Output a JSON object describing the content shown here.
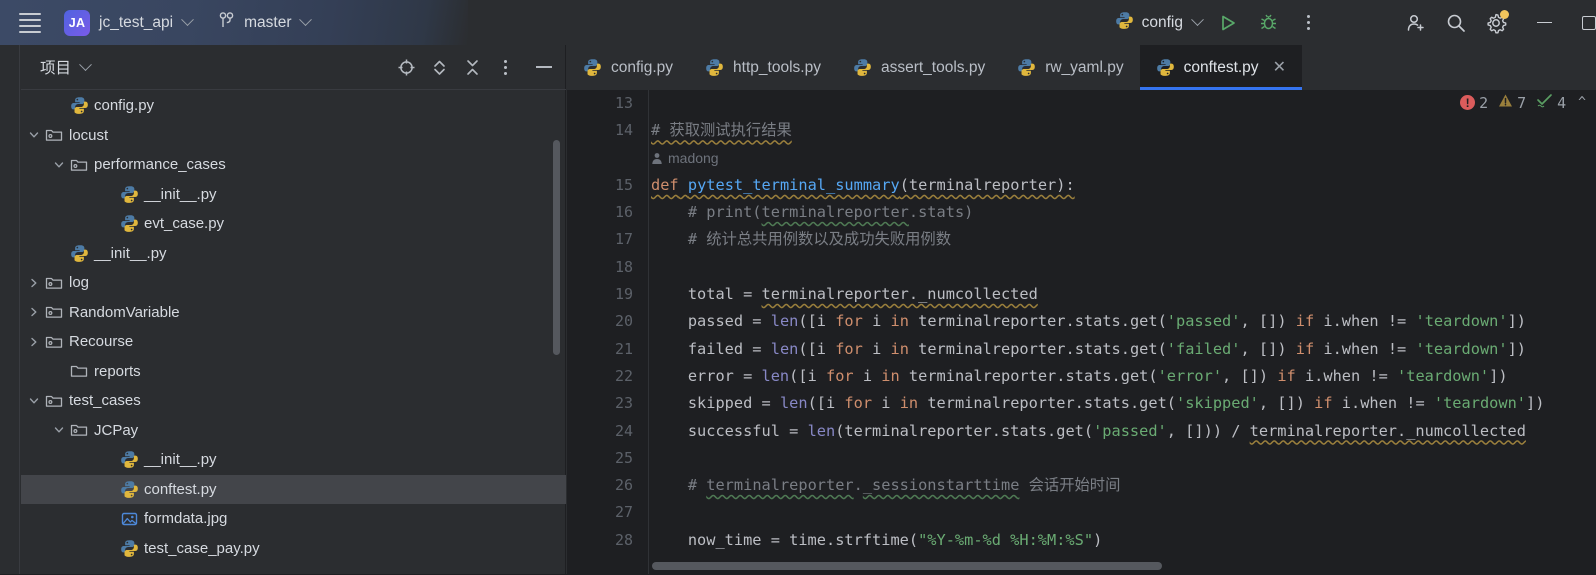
{
  "topbar": {
    "menu_icon": "hamburger-icon",
    "project_badge": "JA",
    "project_name": "jc_test_api",
    "branch_icon": "git-branch-icon",
    "branch_name": "master",
    "run_config_name": "config",
    "run_icon": "run-play-icon",
    "debug_icon": "debug-bug-icon",
    "more_icon": "more-vertical-icon",
    "add_user_icon": "add-user-icon",
    "search_icon": "search-icon",
    "settings_icon": "gear-icon",
    "minimize_icon": "window-minimize-icon",
    "maximize_icon": "window-maximize-icon",
    "accent_blue": "#3574f0",
    "badge_gradient_from": "#4f63e0",
    "badge_gradient_to": "#7a5be8"
  },
  "sidebar": {
    "title": "项目",
    "title_chevron_icon": "chevron-down-icon",
    "icons": [
      {
        "name": "select-opened-file-icon"
      },
      {
        "name": "expand-collapse-icon"
      },
      {
        "name": "collapse-all-icon"
      },
      {
        "name": "options-menu-icon"
      },
      {
        "name": "hide-panel-icon"
      }
    ],
    "tree": [
      {
        "label": "config.py",
        "indent": 3,
        "twist": "",
        "icon": "python-file-icon",
        "selected": false
      },
      {
        "label": "locust",
        "indent": 2,
        "twist": "down",
        "icon": "module-folder-icon",
        "selected": false
      },
      {
        "label": "performance_cases",
        "indent": 3,
        "twist": "down",
        "icon": "module-folder-icon",
        "selected": false
      },
      {
        "label": "__init__.py",
        "indent": 5,
        "twist": "",
        "icon": "python-file-icon",
        "selected": false
      },
      {
        "label": "evt_case.py",
        "indent": 5,
        "twist": "",
        "icon": "python-file-icon",
        "selected": false
      },
      {
        "label": "__init__.py",
        "indent": 3,
        "twist": "",
        "icon": "python-file-icon",
        "selected": false
      },
      {
        "label": "log",
        "indent": 2,
        "twist": "right",
        "icon": "module-folder-icon",
        "selected": false
      },
      {
        "label": "RandomVariable",
        "indent": 2,
        "twist": "right",
        "icon": "module-folder-icon",
        "selected": false
      },
      {
        "label": "Recourse",
        "indent": 2,
        "twist": "right",
        "icon": "module-folder-icon",
        "selected": false
      },
      {
        "label": "reports",
        "indent": 3,
        "twist": "",
        "icon": "plain-folder-icon",
        "selected": false
      },
      {
        "label": "test_cases",
        "indent": 2,
        "twist": "down",
        "icon": "module-folder-icon",
        "selected": false
      },
      {
        "label": "JCPay",
        "indent": 3,
        "twist": "down",
        "icon": "module-folder-icon",
        "selected": false
      },
      {
        "label": "__init__.py",
        "indent": 5,
        "twist": "",
        "icon": "python-file-icon",
        "selected": false
      },
      {
        "label": "conftest.py",
        "indent": 5,
        "twist": "",
        "icon": "python-file-icon",
        "selected": true
      },
      {
        "label": "formdata.jpg",
        "indent": 5,
        "twist": "",
        "icon": "image-file-icon",
        "selected": false
      },
      {
        "label": "test_case_pay.py",
        "indent": 5,
        "twist": "",
        "icon": "python-file-icon",
        "selected": false
      }
    ]
  },
  "editor": {
    "tabs": [
      {
        "label": "config.py",
        "icon": "python-file-icon",
        "active": false,
        "closable": false
      },
      {
        "label": "http_tools.py",
        "icon": "python-file-icon",
        "active": false,
        "closable": false
      },
      {
        "label": "assert_tools.py",
        "icon": "python-file-icon",
        "active": false,
        "closable": false
      },
      {
        "label": "rw_yaml.py",
        "icon": "python-file-icon",
        "active": false,
        "closable": false
      },
      {
        "label": "conftest.py",
        "icon": "python-file-icon",
        "active": true,
        "closable": true,
        "close_label": "✕"
      }
    ],
    "inspections": {
      "error_icon": "error-circle-icon",
      "error_count": "2",
      "warning_icon": "warning-triangle-icon",
      "warning_count": "7",
      "check_icon": "weak-warning-check-icon",
      "check_count": "4",
      "chevron_icon": "chevron-up-icon",
      "error_color": "#db5c5c",
      "warning_color": "#9a7f3c",
      "check_color": "#5a9e63"
    },
    "vcs_annotation": {
      "author_icon": "author-person-icon",
      "author": "madong"
    },
    "lines": [
      {
        "num": "13",
        "html": ""
      },
      {
        "num": "14",
        "html": "<span class=\"cm wav\"># 获取测试执行结果</span>"
      },
      {
        "num": "15",
        "html": "<span class=\"kw wav\">def</span><span class=\"wav\"> </span><span class=\"fn wav\">pytest_terminal_summary</span><span class=\"wav\">(terminalreporter):</span>"
      },
      {
        "num": "16",
        "html": "    <span class=\"cm\"># print(</span><span class=\"cm wavg\">terminalreporter</span><span class=\"cm\">.stats)</span>"
      },
      {
        "num": "17",
        "html": "    <span class=\"cm\"># 统计总共用例数以及成功失败用例数</span>"
      },
      {
        "num": "18",
        "html": ""
      },
      {
        "num": "19",
        "html": "    total = <span class=\"wav\">terminalreporter._numcollected</span>"
      },
      {
        "num": "20",
        "html": "    passed = <span class=\"bi\">len</span>([i <span class=\"kw\">for</span> i <span class=\"kw\">in</span> terminalreporter.stats.get(<span class=\"str\">'passed'</span>, []) <span class=\"kw\">if</span> i.when != <span class=\"str\">'teardown'</span>])"
      },
      {
        "num": "21",
        "html": "    failed = <span class=\"bi\">len</span>([i <span class=\"kw\">for</span> i <span class=\"kw\">in</span> terminalreporter.stats.get(<span class=\"str\">'failed'</span>, []) <span class=\"kw\">if</span> i.when != <span class=\"str\">'teardown'</span>])"
      },
      {
        "num": "22",
        "html": "    error = <span class=\"bi\">len</span>([i <span class=\"kw\">for</span> i <span class=\"kw\">in</span> terminalreporter.stats.get(<span class=\"str\">'error'</span>, []) <span class=\"kw\">if</span> i.when != <span class=\"str\">'teardown'</span>])"
      },
      {
        "num": "23",
        "html": "    skipped = <span class=\"bi\">len</span>([i <span class=\"kw\">for</span> i <span class=\"kw\">in</span> terminalreporter.stats.get(<span class=\"str\">'skipped'</span>, []) <span class=\"kw\">if</span> i.when != <span class=\"str\">'teardown'</span>])"
      },
      {
        "num": "24",
        "html": "    successful = <span class=\"bi\">len</span>(terminalreporter.stats.get(<span class=\"str\">'passed'</span>, [])) / <span class=\"wav\">terminalreporter._numcollected</span>"
      },
      {
        "num": "25",
        "html": ""
      },
      {
        "num": "26",
        "html": "    <span class=\"cm\"># </span><span class=\"cm wavg\">terminalreporter</span><span class=\"cm\">.</span><span class=\"cm wavg\">_sessionstarttime</span><span class=\"cm\"> 会话开始时间</span>"
      },
      {
        "num": "27",
        "html": ""
      },
      {
        "num": "28",
        "html": "    now_time = time.strftime(<span class=\"str\">\"%Y-%m-%d %H:%M:%S\"</span>)"
      }
    ]
  }
}
